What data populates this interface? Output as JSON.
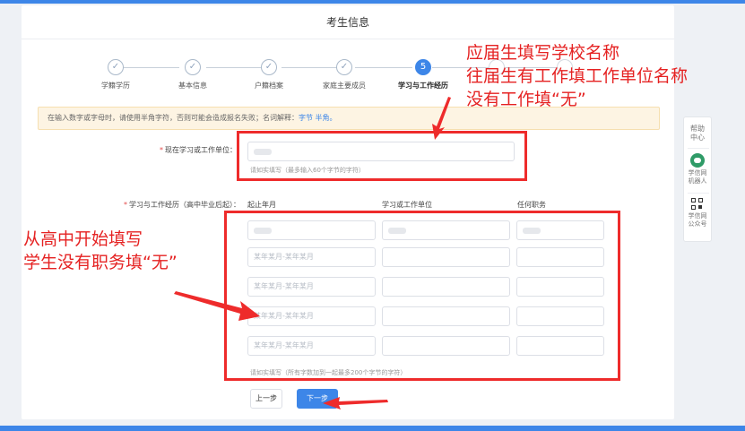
{
  "page": {
    "title": "考生信息"
  },
  "steps": [
    {
      "label": "学籍学历",
      "state": "done",
      "symbol": "✓"
    },
    {
      "label": "基本信息",
      "state": "done",
      "symbol": "✓"
    },
    {
      "label": "户籍档案",
      "state": "done",
      "symbol": "✓"
    },
    {
      "label": "家庭主要成员",
      "state": "done",
      "symbol": "✓"
    },
    {
      "label": "学习与工作经历",
      "state": "active",
      "symbol": "5"
    },
    {
      "label": "",
      "state": "todo",
      "symbol": ""
    },
    {
      "label": "",
      "state": "todo",
      "symbol": ""
    }
  ],
  "notice": {
    "text": "在输入数字或字母时，请使用半角字符，否则可能会造成报名失败；名词解释：",
    "link_text": "字节 半角。"
  },
  "current_unit": {
    "label": "现在学习或工作单位：",
    "required_mark": "*",
    "hint": "请如实填写（最多输入60个字节的字符）"
  },
  "history": {
    "label": "学习与工作经历（高中毕业后起）：",
    "required_mark": "*",
    "columns": [
      "起止年月",
      "学习或工作单位",
      "任何职务"
    ],
    "row_placeholder": "某年某月-某年某月",
    "rows_count_visible": 5,
    "hint": "请如实填写（所有字数加到一起最多200个字节的字符）"
  },
  "buttons": {
    "prev": "上一步",
    "next": "下一步"
  },
  "side_panel": {
    "help": "帮助\n中心",
    "robot": "学信网\n机器人",
    "official": "学信网\n公众号"
  },
  "annotations": {
    "top_right": [
      "应届生填写学校名称",
      "往届生有工作填工作单位名称",
      "没有工作填“无”"
    ],
    "left": [
      "从高中开始填写",
      "学生没有职务填“无”"
    ]
  },
  "colors": {
    "accent": "#3d86e8",
    "annotation": "#ee2b2b",
    "notice_bg": "#fdf4e3"
  }
}
